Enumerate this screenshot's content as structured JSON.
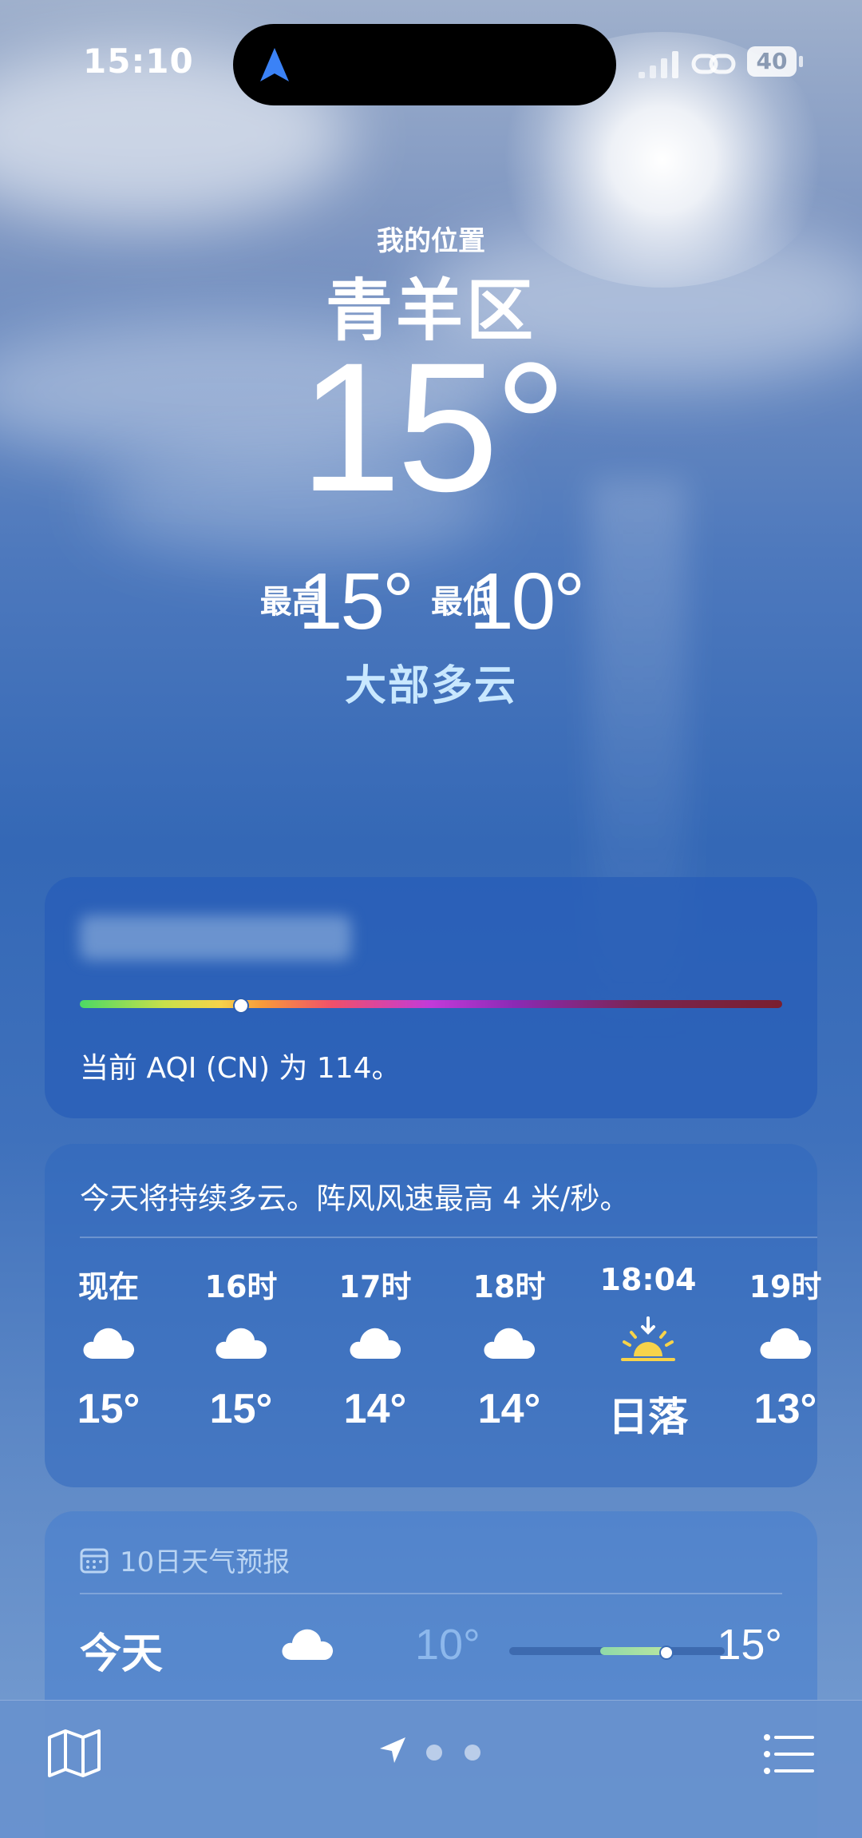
{
  "status_bar": {
    "time": "15:10",
    "battery": "40",
    "icons": [
      "location-arrow-icon",
      "signal-icon",
      "link-icon",
      "battery-icon"
    ]
  },
  "header": {
    "location_label": "我的位置",
    "city": "青羊区",
    "temperature": "15°",
    "high_label": "最高",
    "high": "15°",
    "low_label": "最低",
    "low": "10°",
    "condition": "大部多云"
  },
  "aqi": {
    "description": "当前 AQI (CN) 为 114。",
    "level_fraction": 0.23,
    "colors": [
      "#4cd964",
      "#f7d34a",
      "#f0506a",
      "#c23ad9",
      "#7a1f2f"
    ]
  },
  "hourly": {
    "summary": "今天将持续多云。阵风风速最高 4 米/秒。",
    "items": [
      {
        "label": "现在",
        "icon": "cloud-icon",
        "temp": "15°"
      },
      {
        "label": "16时",
        "icon": "cloud-icon",
        "temp": "15°"
      },
      {
        "label": "17时",
        "icon": "cloud-icon",
        "temp": "14°"
      },
      {
        "label": "18时",
        "icon": "cloud-icon",
        "temp": "14°"
      },
      {
        "label": "18:04",
        "icon": "sunset-icon",
        "temp": "日落"
      },
      {
        "label": "19时",
        "icon": "cloud-icon",
        "temp": "13°"
      }
    ]
  },
  "forecast": {
    "title": "10日天气预报",
    "rows": [
      {
        "day": "今天",
        "icon": "cloud-icon",
        "low": "10°",
        "high": "15°"
      }
    ]
  },
  "toolbar": {
    "icons": [
      "map-icon",
      "location-arrow-icon",
      "page-dot",
      "page-dot",
      "list-icon"
    ]
  }
}
